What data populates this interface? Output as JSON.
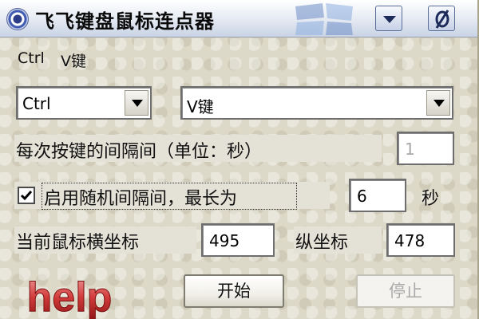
{
  "window": {
    "title": "飞飞键盘鼠标连点器"
  },
  "hotkey_label": {
    "modifier": "Ctrl",
    "key": "V键"
  },
  "modifier_select": {
    "value": "Ctrl"
  },
  "key_select": {
    "value": "V键"
  },
  "interval": {
    "label": "每次按键的间隔间（单位：秒）",
    "value": "1"
  },
  "random_interval": {
    "checked": true,
    "label": "启用随机间隔间，最长为",
    "max_value": "6",
    "unit": "秒"
  },
  "mouse_position": {
    "x_label": "当前鼠标横坐标",
    "x_value": "495",
    "y_label": "纵坐标",
    "y_value": "478"
  },
  "buttons": {
    "help": "help",
    "start": "开始",
    "stop": "停止"
  },
  "colors": {
    "window_background": "#ddd9c8",
    "titlebar": "#dfe6f2",
    "help_red": "#c0262a",
    "disabled_text": "#a9a9a9"
  }
}
